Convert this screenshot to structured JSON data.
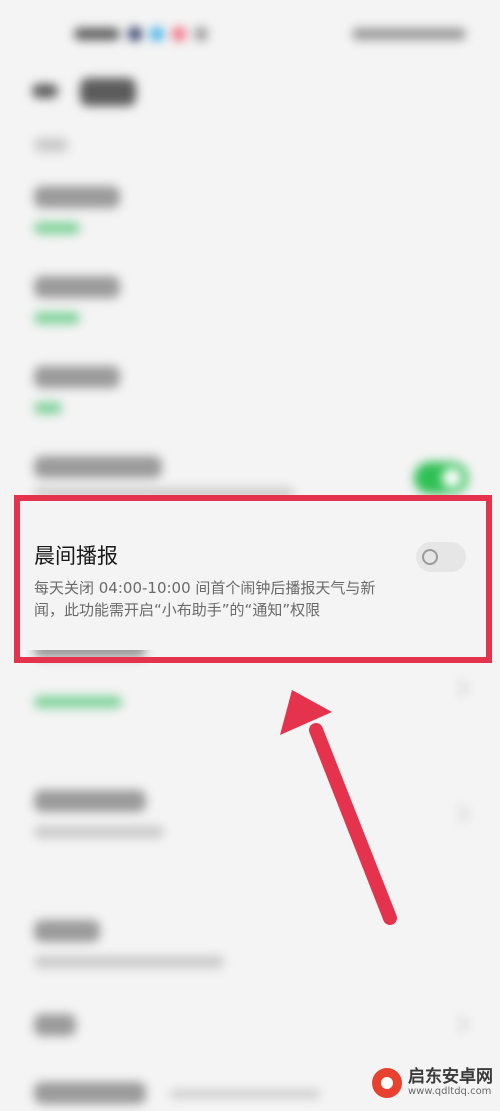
{
  "morning_broadcast": {
    "title": "晨间播报",
    "description": "每天关闭 04:00-10:00 间首个闹钟后播报天气与新闻，此功能需开启“小布助手”的“通知”权限",
    "enabled": false
  },
  "icons": {
    "back": "back-arrow-icon",
    "chevron": "chevron-right-icon"
  },
  "colors": {
    "highlight": "#e5334e",
    "toggle_on": "#2ec053",
    "accent_green": "#2ec053"
  },
  "watermark": {
    "name": "启东安卓网",
    "url": "www.qdltdq.com"
  }
}
